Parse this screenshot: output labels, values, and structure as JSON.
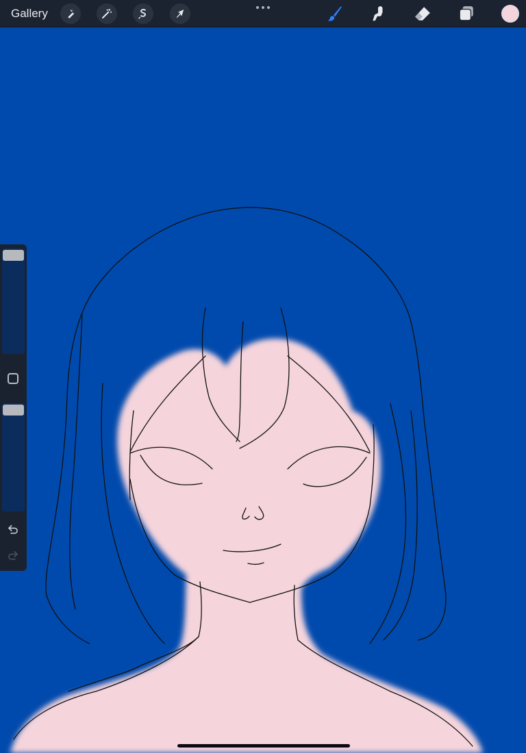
{
  "toolbar": {
    "gallery_label": "Gallery",
    "left_tools": [
      {
        "name": "actions",
        "icon": "wrench-icon"
      },
      {
        "name": "adjustments",
        "icon": "magic-wand-icon"
      },
      {
        "name": "selection",
        "icon": "selection-s-icon"
      },
      {
        "name": "transform",
        "icon": "arrow-cursor-icon"
      }
    ],
    "right_tools": [
      {
        "name": "brush",
        "icon": "brush-icon",
        "active": true
      },
      {
        "name": "smudge",
        "icon": "smudge-finger-icon",
        "active": false
      },
      {
        "name": "eraser",
        "icon": "eraser-icon",
        "active": false
      },
      {
        "name": "layers",
        "icon": "layers-icon",
        "active": false
      }
    ],
    "current_color": "#f5d4dc"
  },
  "colors": {
    "canvas_background": "#014aad",
    "skin": "#f5d4dc",
    "line_art": "#111111",
    "active_tool": "#2f7ff6"
  },
  "sidebar": {
    "brush_size": 1.0,
    "brush_opacity": 1.0,
    "undo_icon": "undo-arrow-icon",
    "redo_icon": "redo-arrow-icon",
    "modify_icon": "square-outline-icon"
  }
}
